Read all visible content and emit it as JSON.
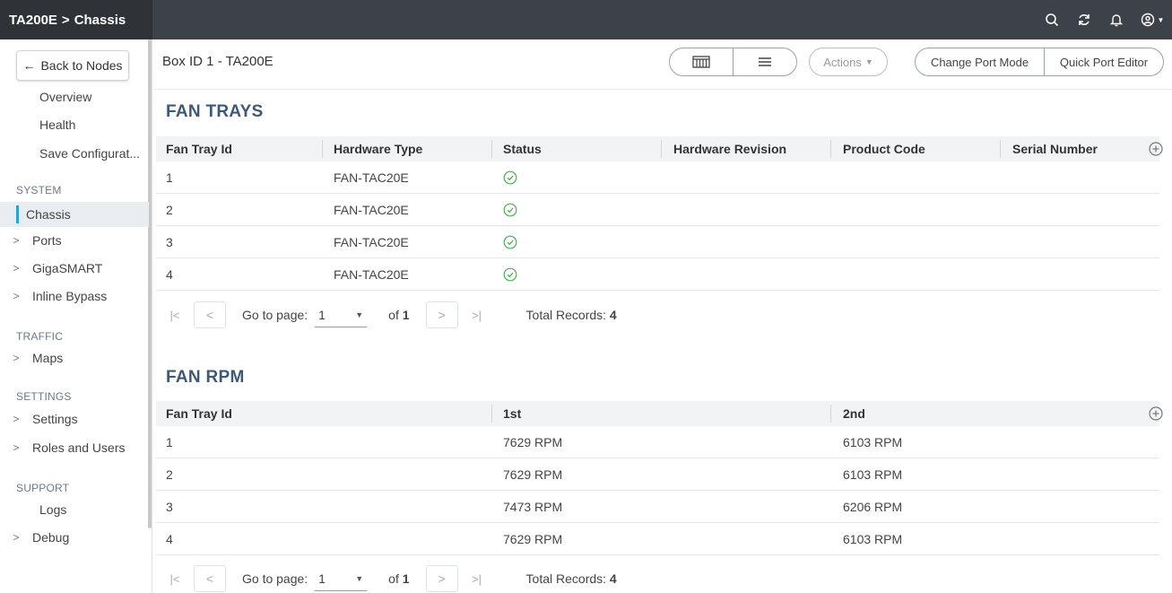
{
  "topbar": {
    "brand": "TA200E",
    "crumb_sep": ">",
    "crumb": "Chassis"
  },
  "sidebar": {
    "back_label": "Back to Nodes",
    "top_items": [
      "Overview",
      "Health",
      "Save Configurat..."
    ],
    "sections": {
      "system": "SYSTEM",
      "traffic": "TRAFFIC",
      "settings": "SETTINGS",
      "support": "SUPPORT"
    },
    "system_items": [
      "Chassis",
      "Ports",
      "GigaSMART",
      "Inline Bypass"
    ],
    "traffic_items": [
      "Maps"
    ],
    "settings_items": [
      "Settings",
      "Roles and Users"
    ],
    "support_items": [
      "Logs",
      "Debug"
    ]
  },
  "header": {
    "title": "Box ID 1 - TA200E",
    "actions_label": "Actions",
    "change_port_mode": "Change Port Mode",
    "quick_port_editor": "Quick Port Editor"
  },
  "fan_trays": {
    "title": "FAN TRAYS",
    "columns": [
      "Fan Tray Id",
      "Hardware Type",
      "Status",
      "Hardware Revision",
      "Product Code",
      "Serial Number"
    ],
    "rows": [
      {
        "id": "1",
        "hardware_type": "FAN-TAC20E",
        "status": "ok"
      },
      {
        "id": "2",
        "hardware_type": "FAN-TAC20E",
        "status": "ok"
      },
      {
        "id": "3",
        "hardware_type": "FAN-TAC20E",
        "status": "ok"
      },
      {
        "id": "4",
        "hardware_type": "FAN-TAC20E",
        "status": "ok"
      }
    ],
    "pager": {
      "goto": "Go to page:",
      "page": "1",
      "of": "of",
      "pages": "1",
      "total_label": "Total Records:",
      "total": "4"
    }
  },
  "fan_rpm": {
    "title": "FAN RPM",
    "columns": [
      "Fan Tray Id",
      "1st",
      "2nd"
    ],
    "rows": [
      {
        "id": "1",
        "first": "7629 RPM",
        "second": "6103 RPM"
      },
      {
        "id": "2",
        "first": "7629 RPM",
        "second": "6103 RPM"
      },
      {
        "id": "3",
        "first": "7473 RPM",
        "second": "6206 RPM"
      },
      {
        "id": "4",
        "first": "7629 RPM",
        "second": "6103 RPM"
      }
    ],
    "pager": {
      "goto": "Go to page:",
      "page": "1",
      "of": "of",
      "pages": "1",
      "total_label": "Total Records:",
      "total": "4"
    }
  },
  "colors": {
    "topbar": "#3d4148",
    "accent": "#2a9fd8",
    "section_title": "#3c5a78",
    "status_ok": "#4caf50"
  }
}
